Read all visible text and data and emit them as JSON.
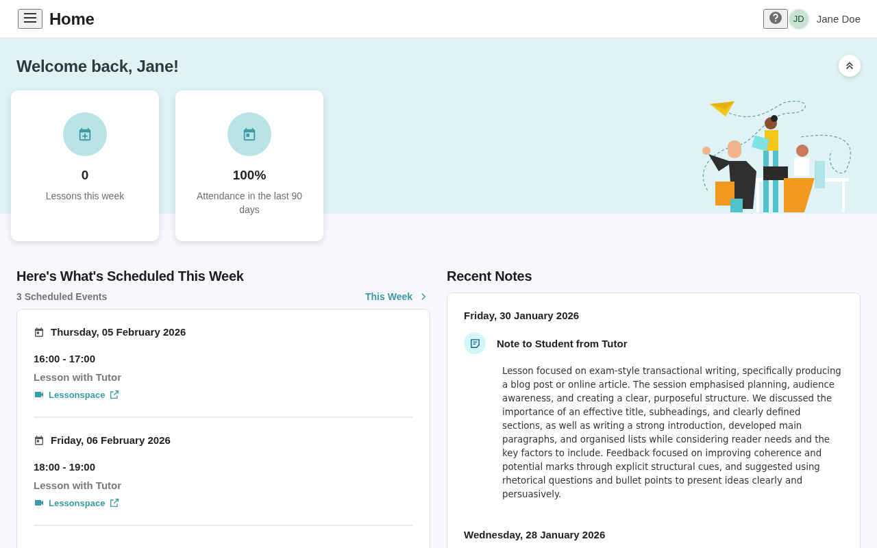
{
  "header": {
    "title": "Home",
    "user": {
      "initials": "JD",
      "name": "Jane Doe"
    }
  },
  "hero": {
    "greeting": "Welcome back, Jane!",
    "stats": [
      {
        "kind": "lessons",
        "value": "0",
        "label": "Lessons this week"
      },
      {
        "kind": "attendance",
        "value": "100%",
        "label": "Attendance in the last 90 days"
      }
    ]
  },
  "schedule": {
    "title": "Here's What's Scheduled This Week",
    "count": "3 Scheduled Events",
    "range_link": "This Week",
    "events": [
      {
        "date": "Thursday, 05 February 2026",
        "time": "16:00 - 17:00",
        "title": "Lesson with Tutor",
        "location": "Lessonspace"
      },
      {
        "date": "Friday, 06 February 2026",
        "time": "18:00 - 19:00",
        "title": "Lesson with Tutor",
        "location": "Lessonspace"
      }
    ]
  },
  "notes": {
    "title": "Recent Notes",
    "entries": [
      {
        "date": "Friday, 30 January 2026",
        "title": "Note to Student from Tutor",
        "body": "Lesson focused on exam-style transactional writing, specifically producing a blog post or online article. The session emphasised planning, audience awareness, and creating a clear, purposeful structure. We discussed the importance of an effective title, subheadings, and clearly defined sections, as well as writing a strong introduction, developed main paragraphs, and organised lists while considering reader needs and the key factors to include. Feedback focused on improving coherence and potential marks through explicit structural cues, and suggested using rhetorical questions and bullet points to present ideas clearly and persuasively."
      },
      {
        "date": "Wednesday, 28 January 2026"
      }
    ]
  }
}
